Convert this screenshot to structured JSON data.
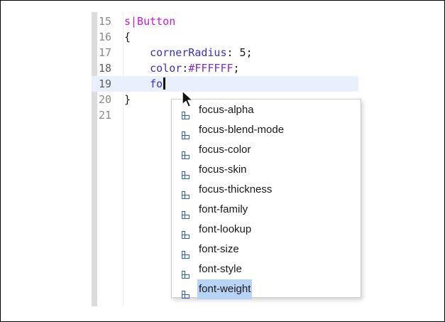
{
  "editor": {
    "lines": [
      {
        "no": "15",
        "segments": [
          {
            "text": "s|Button",
            "cls": "kw"
          }
        ]
      },
      {
        "no": "16",
        "segments": [
          {
            "text": "{",
            "cls": ""
          }
        ]
      },
      {
        "no": "17",
        "segments": [
          {
            "text": "    ",
            "cls": ""
          },
          {
            "text": "cornerRadius",
            "cls": "prop"
          },
          {
            "text": ": 5;",
            "cls": ""
          }
        ]
      },
      {
        "no": "18",
        "segments": [
          {
            "text": "    ",
            "cls": ""
          },
          {
            "text": "color",
            "cls": "prop"
          },
          {
            "text": ":",
            "cls": ""
          },
          {
            "text": "#FFFFFF",
            "cls": "val"
          },
          {
            "text": ";",
            "cls": ""
          }
        ]
      },
      {
        "no": "19",
        "segments": [
          {
            "text": "    ",
            "cls": ""
          },
          {
            "text": "fo",
            "cls": "prop"
          }
        ]
      },
      {
        "no": "20",
        "segments": [
          {
            "text": "}",
            "cls": ""
          }
        ]
      },
      {
        "no": "21",
        "segments": []
      }
    ],
    "current_line": "19"
  },
  "autocomplete": {
    "items": [
      "focus-alpha",
      "focus-blend-mode",
      "focus-color",
      "focus-skin",
      "focus-thickness",
      "font-family",
      "font-lookup",
      "font-size",
      "font-style",
      "font-weight"
    ],
    "selected": "font-weight",
    "item_icon": "property-icon",
    "icon_color": "#2b5fb8",
    "highlight_color": "#b7d3f6"
  }
}
